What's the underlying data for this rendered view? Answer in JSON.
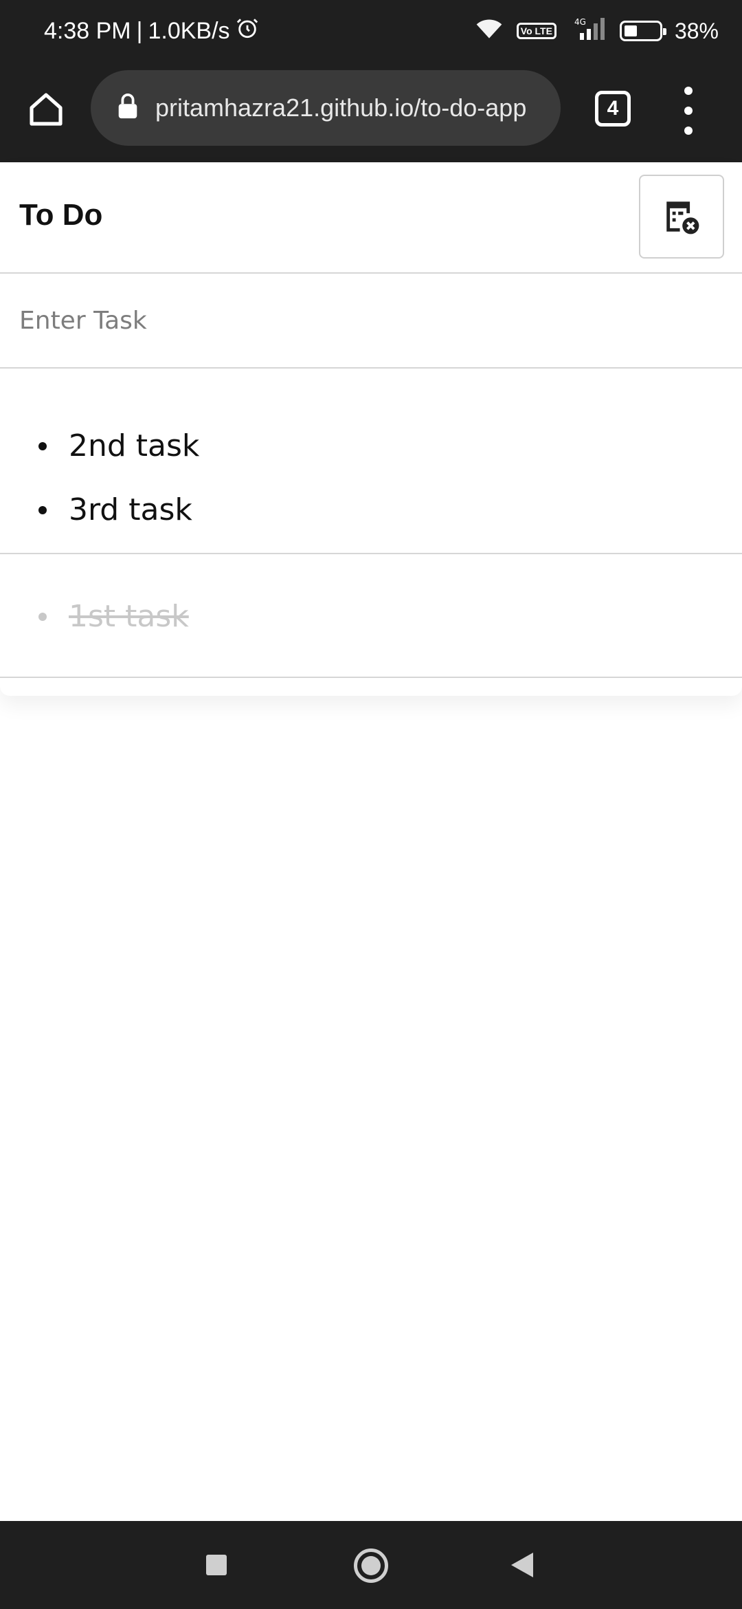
{
  "status_bar": {
    "time": "4:38 PM",
    "speed": "1.0KB/s",
    "volte": "Vo LTE",
    "network": "4G",
    "battery": "38%",
    "icons": [
      "alarm-icon",
      "wifi-icon",
      "signal-icon",
      "battery-icon"
    ]
  },
  "browser": {
    "url": "pritamhazra21.github.io/to-do-app",
    "tab_count": "4",
    "icons": [
      "home-icon",
      "lock-icon",
      "tabs-icon",
      "more-menu-icon"
    ]
  },
  "app": {
    "title": "To Do",
    "clear_button_icon": "clear-list-icon",
    "input_placeholder": "Enter Task",
    "input_value": "",
    "pending_tasks": [
      {
        "text": "2nd task"
      },
      {
        "text": "3rd task"
      }
    ],
    "completed_tasks": [
      {
        "text": "1st task"
      }
    ]
  },
  "nav": {
    "icons": [
      "recents-icon",
      "home-nav-icon",
      "back-icon"
    ]
  },
  "colors": {
    "system_bar": "#1f1f1f",
    "url_box": "#3a3a3a",
    "divider": "#d6d6d6",
    "completed_text": "#c8c8c8"
  }
}
